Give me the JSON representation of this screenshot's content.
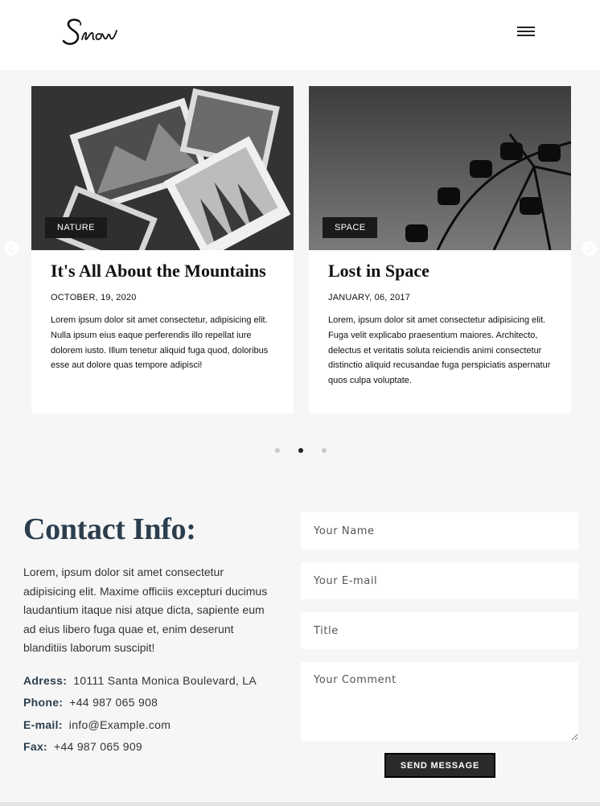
{
  "header": {
    "logo_text": "Snow",
    "menu_icon": "hamburger-icon"
  },
  "slider": {
    "prev_icon": "chevron-left-icon",
    "next_icon": "chevron-right-icon",
    "active_dot_index": 1,
    "dot_count": 3,
    "cards": [
      {
        "tag": "NATURE",
        "title": "It's All About the Mountains",
        "date": "OCTOBER, 19, 2020",
        "text": "Lorem ipsum dolor sit amet consectetur, adipisicing elit. Nulla ipsum eius eaque perferendis illo repellat iure dolorem iusto. Illum tenetur aliquid fuga quod, doloribus esse aut dolore quas tempore adipisci!"
      },
      {
        "tag": "SPACE",
        "title": "Lost in Space",
        "date": "JANUARY, 06, 2017",
        "text": "Lorem, ipsum dolor sit amet consectetur adipisicing elit. Fuga velit explicabo praesentium maiores. Architecto, delectus et veritatis soluta reiciendis animi consectetur distinctio aliquid recusandae fuga perspiciatis aspernatur quos culpa voluptate."
      }
    ]
  },
  "contact": {
    "title": "Contact Info:",
    "description": "Lorem, ipsum dolor sit amet consectetur adipisicing elit. Maxime officiis excepturi ducimus laudantium itaque nisi atque dicta, sapiente eum ad eius libero fuga quae et, enim deserunt blanditiis laborum suscipit!",
    "info": [
      {
        "label": "Adress:",
        "value": "10111 Santa Monica Boulevard, LA"
      },
      {
        "label": "Phone:",
        "value": "+44 987 065 908"
      },
      {
        "label": "E-mail:",
        "value": "info@Example.com"
      },
      {
        "label": "Fax:",
        "value": "+44 987 065 909"
      }
    ]
  },
  "form": {
    "name_placeholder": "Your Name",
    "email_placeholder": "Your E-mail",
    "title_placeholder": "Title",
    "comment_placeholder": "Your Comment",
    "submit_label": "SEND MESSAGE"
  },
  "colors": {
    "page_bg": "#f6f6f6",
    "heading": "#2b3e4e",
    "tag_bg": "#1a1a1a",
    "button_bg": "#2a2a2a"
  }
}
